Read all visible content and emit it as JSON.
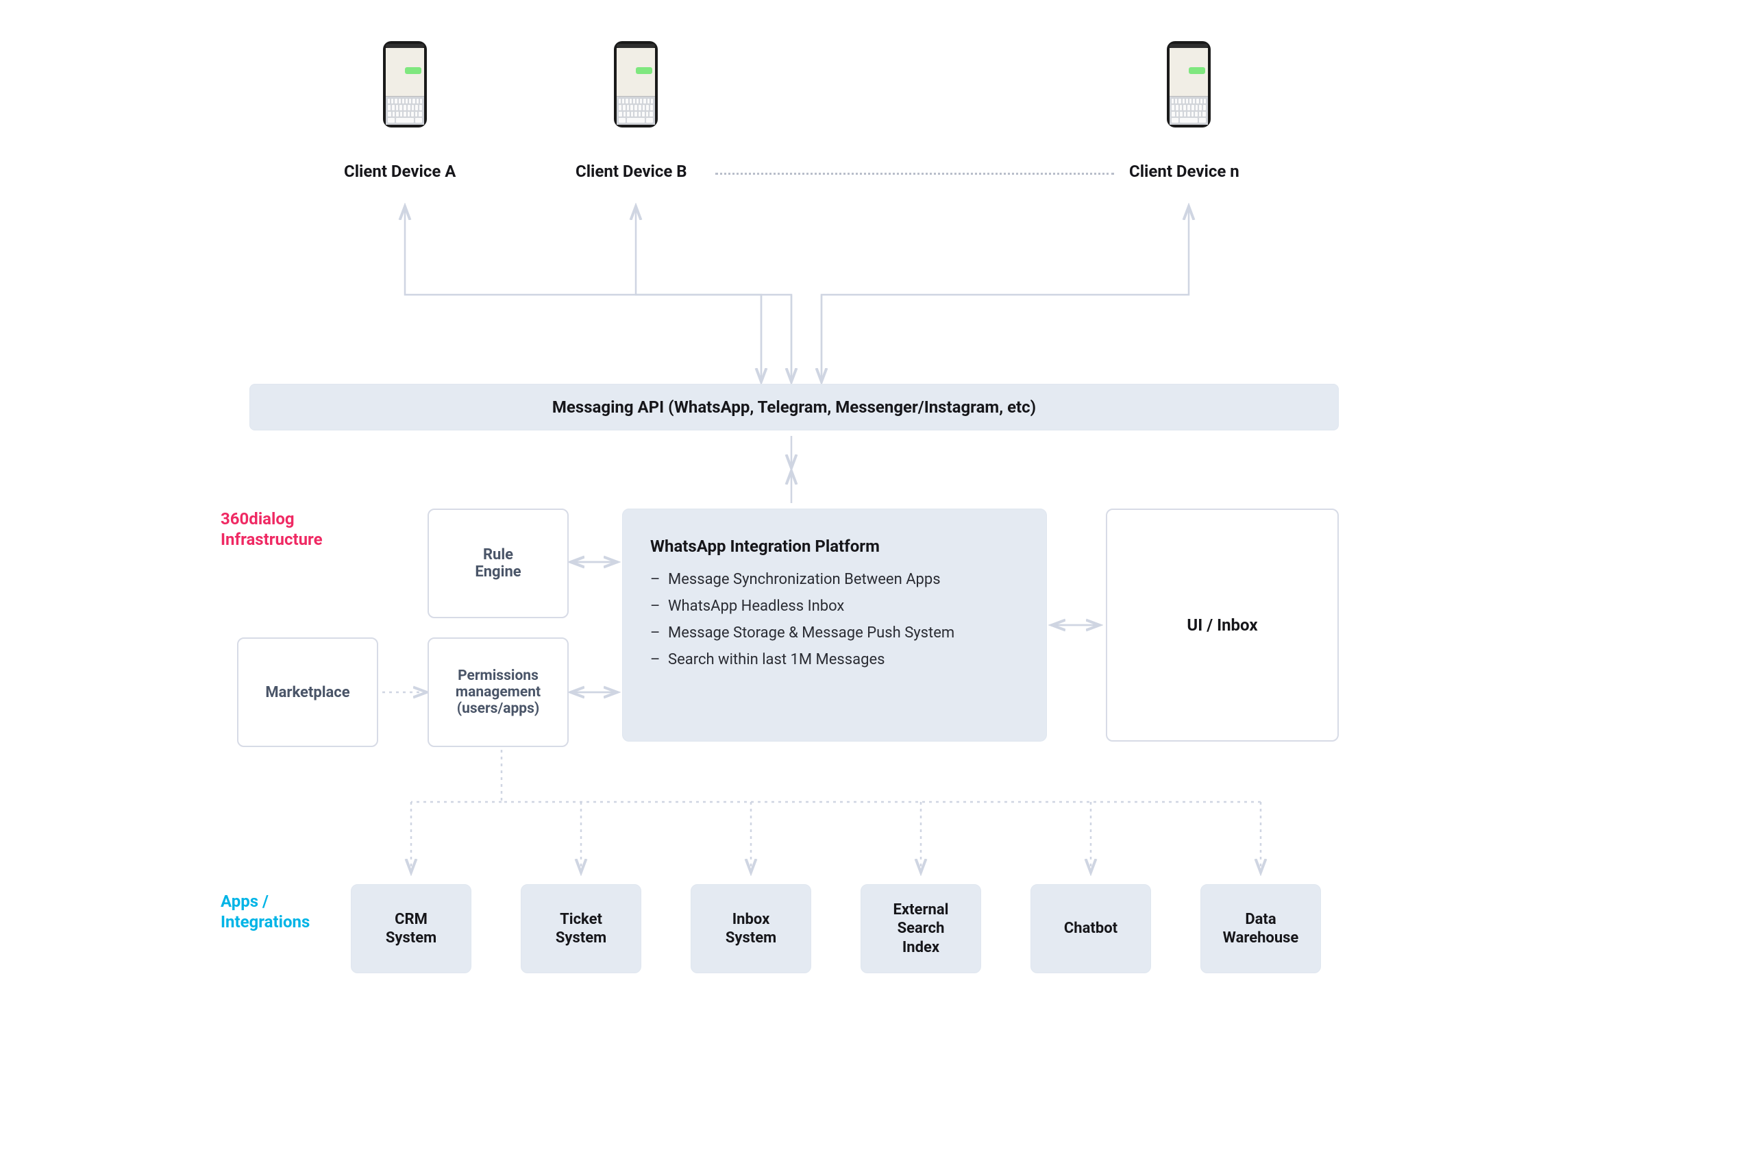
{
  "devices": {
    "a": "Client Device A",
    "b": "Client Device B",
    "n": "Client Device n"
  },
  "api_bar": "Messaging API (WhatsApp, Telegram, Messenger/Instagram, etc)",
  "sections": {
    "infra_line1": "360dialog",
    "infra_line2": "Infrastructure",
    "apps_line1": "Apps /",
    "apps_line2": "Integrations"
  },
  "infra": {
    "rule_engine": "Rule\nEngine",
    "permissions": "Permissions\nmanagement\n(users/apps)",
    "marketplace": "Marketplace",
    "ui_inbox": "UI / Inbox",
    "platform_title": "WhatsApp Integration Platform",
    "platform_items": [
      "Message Synchronization Between Apps",
      "WhatsApp Headless Inbox",
      "Message Storage & Message Push System",
      "Search within last 1M Messages"
    ]
  },
  "apps": [
    "CRM\nSystem",
    "Ticket\nSystem",
    "Inbox\nSystem",
    "External\nSearch\nIndex",
    "Chatbot",
    "Data\nWarehouse"
  ]
}
